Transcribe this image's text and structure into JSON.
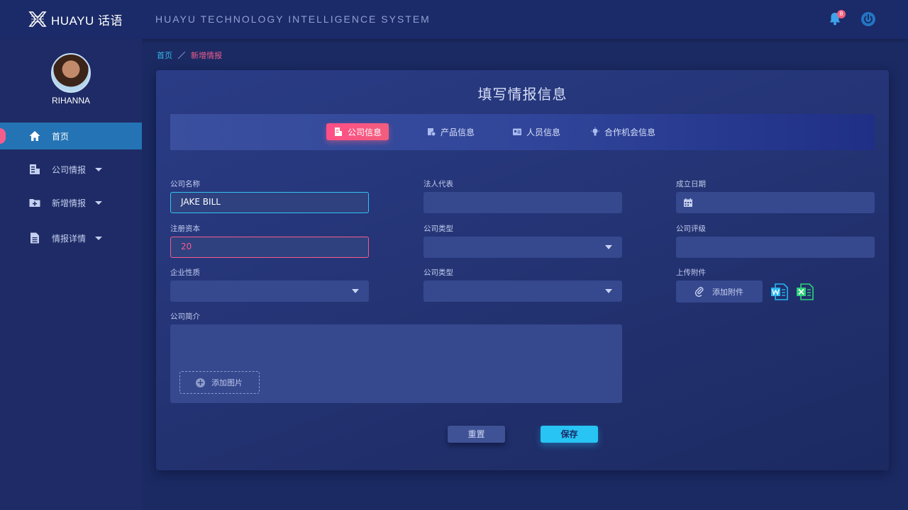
{
  "header": {
    "logo_text": "HUAYU 话语",
    "system_title": "HUAYU TECHNOLOGY INTELLIGENCE SYSTEM",
    "notification_count": "8",
    "icons": [
      "bell-icon",
      "power-icon"
    ]
  },
  "sidebar": {
    "username": "RIHANNA",
    "items": [
      {
        "label": "首页",
        "icon": "home-icon",
        "active": true
      },
      {
        "label": "公司情报",
        "icon": "building-doc-icon",
        "caret": true
      },
      {
        "label": "新增情报",
        "icon": "folder-plus-icon",
        "caret": true
      },
      {
        "label": "情报详情",
        "icon": "document-icon",
        "caret": true
      }
    ]
  },
  "breadcrumb": {
    "home": "首页",
    "current": "新增情报"
  },
  "panel": {
    "title": "填写情报信息",
    "tabs": [
      {
        "label": "公司信息",
        "icon": "company-doc-icon",
        "active": true
      },
      {
        "label": "产品信息",
        "icon": "product-icon"
      },
      {
        "label": "人员信息",
        "icon": "id-card-icon"
      },
      {
        "label": "合作机会信息",
        "icon": "lightbulb-icon"
      }
    ]
  },
  "form": {
    "company_name": {
      "label": "公司名称",
      "value": "JAKE BILL"
    },
    "legal_rep": {
      "label": "法人代表",
      "value": ""
    },
    "founded_date": {
      "label": "成立日期",
      "value": ""
    },
    "registered_capital": {
      "label": "注册资本",
      "value": "20"
    },
    "company_type_1": {
      "label": "公司类型",
      "value": ""
    },
    "company_rating": {
      "label": "公司评级",
      "value": ""
    },
    "enterprise_nature": {
      "label": "企业性质",
      "value": ""
    },
    "company_type_2": {
      "label": "公司类型",
      "value": ""
    },
    "attachment": {
      "label": "上传附件",
      "button": "添加附件",
      "files": [
        "word-file-icon",
        "excel-file-icon"
      ]
    },
    "description": {
      "label": "公司简介",
      "add_image": "添加图片"
    }
  },
  "actions": {
    "reset": "重置",
    "save": "保存"
  },
  "colors": {
    "accent_pink": "#f25d8c",
    "accent_cyan": "#27c4f4",
    "nav_active": "#2474b5"
  }
}
